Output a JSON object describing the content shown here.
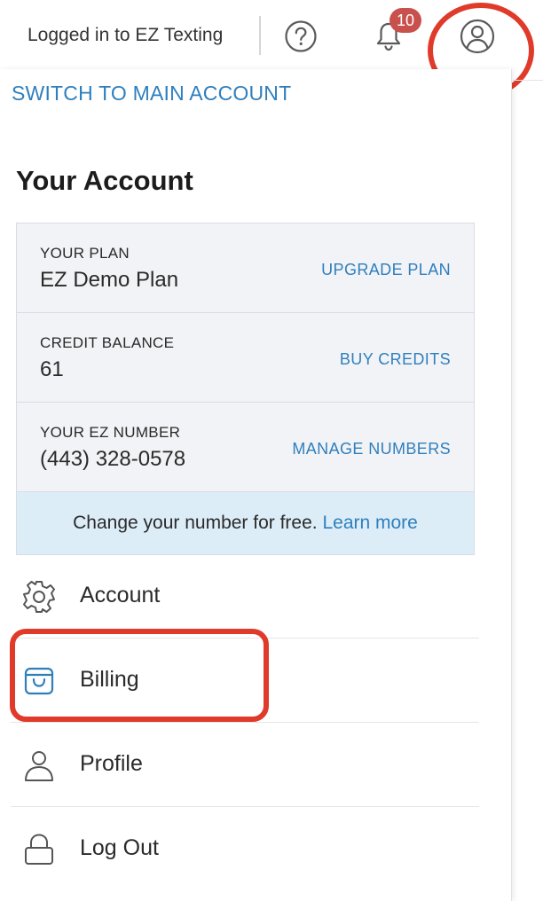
{
  "topbar": {
    "status_text": "Logged in to EZ Texting",
    "help_icon": "help-circle-icon",
    "notifications_icon": "bell-icon",
    "notifications_count": "10",
    "user_icon": "user-circle-icon"
  },
  "panel": {
    "switch_link": "SWITCH TO MAIN ACCOUNT",
    "title": "Your Account",
    "card": {
      "rows": [
        {
          "label": "YOUR PLAN",
          "value": "EZ Demo Plan",
          "action": "UPGRADE PLAN"
        },
        {
          "label": "CREDIT BALANCE",
          "value": "61",
          "action": "BUY CREDITS"
        },
        {
          "label": "YOUR EZ NUMBER",
          "value": "(443) 328-0578",
          "action": "MANAGE NUMBERS"
        }
      ],
      "info_text": "Change your number for free.",
      "info_link": "Learn more"
    },
    "menu": [
      {
        "label": "Account",
        "icon": "gear-icon"
      },
      {
        "label": "Billing",
        "icon": "shopping-bag-icon"
      },
      {
        "label": "Profile",
        "icon": "person-icon"
      },
      {
        "label": "Log Out",
        "icon": "lock-icon"
      }
    ]
  },
  "colors": {
    "link": "#2f7fbd",
    "highlight": "#e03b2a",
    "badge": "#c9514d",
    "card_bg": "#f2f3f6",
    "info_bg": "#dcedf8"
  }
}
